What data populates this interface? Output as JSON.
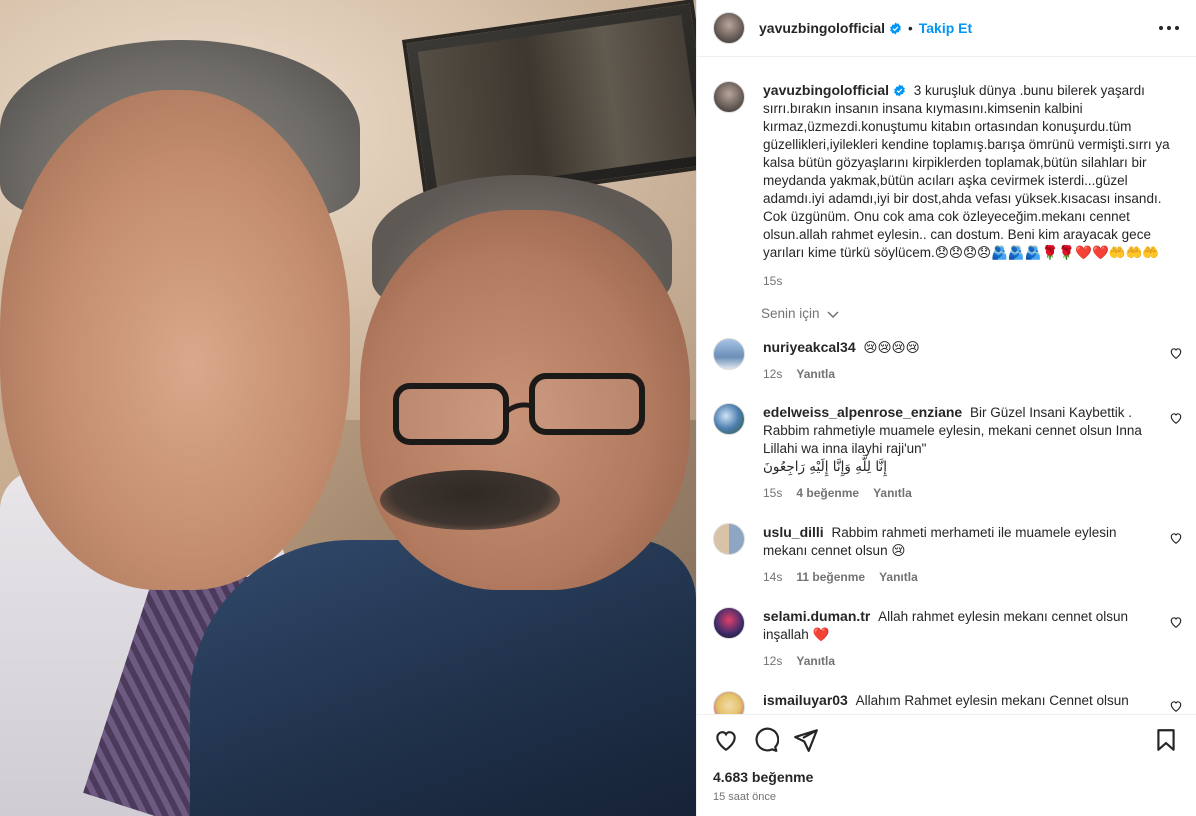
{
  "header": {
    "username": "yavuzbingolofficial",
    "separator": "•",
    "follow_label": "Takip Et"
  },
  "caption": {
    "username": "yavuzbingolofficial",
    "text": "3 kuruşluk dünya .bunu bilerek yaşardı sırrı.bırakın insanın insana kıymasını.kimsenin kalbini kırmaz,üzmezdi.konuştumu kitabın ortasından konuşurdu.tüm güzellikleri,iyilekleri kendine toplamış.barışa ömrünü vermişti.sırrı ya kalsa bütün gözyaşlarını kirpiklerden toplamak,bütün silahları bir meydanda yakmak,bütün acıları aşka cevirmek isterdi...güzel adamdı.iyi adamdı,iyi bir dost,ahda vefası yüksek.kısacası insandı. Cok üzgünüm. Onu cok ama cok özleyeceğim.mekanı cennet olsun.allah rahmet eylesin.. can dostum. Beni kim arayacak gece yarıları kime türkü söylücem.😞😞😞😞🫂🫂🫂🌹🌹❤️❤️🤲🤲🤲",
    "time": "15s"
  },
  "for_you": "Senin için",
  "comments": [
    {
      "username": "nuriyeakcal34",
      "text": "😢😢😢😢",
      "time": "12s",
      "likes": "",
      "reply": "Yanıtla"
    },
    {
      "username": "edelweiss_alpenrose_enziane",
      "text": "Bir Güzel Insani Kaybettik . Rabbim rahmetiyle muamele eylesin, mekani cennet olsun Inna Lillahi wa inna ilayhi raji'un\"",
      "arabic": "إِنَّا لِلَّهِ وَإِنَّا إِلَيْهِ رَاجِعُونَ",
      "time": "15s",
      "likes": "4 beğenme",
      "reply": "Yanıtla"
    },
    {
      "username": "uslu_dilli",
      "text": "Rabbim rahmeti merhameti ile muamele eylesin mekanı cennet olsun 😢",
      "time": "14s",
      "likes": "11 beğenme",
      "reply": "Yanıtla"
    },
    {
      "username": "selami.duman.tr",
      "text": "Allah rahmet eylesin mekanı cennet olsun inşallah ❤️",
      "time": "12s",
      "likes": "",
      "reply": "Yanıtla"
    },
    {
      "username": "ismailuyar03",
      "text": "Allahım Rahmet eylesin mekanı Cennet olsun",
      "time": "",
      "likes": "",
      "reply": ""
    }
  ],
  "footer": {
    "likes": "4.683 beğenme",
    "ago": "15 saat önce"
  },
  "colors": {
    "accent": "#0095f6",
    "verified": "#0095f6",
    "muted": "#737373",
    "text": "#262626"
  },
  "icons": {
    "more": "more-horizontal-icon",
    "heart": "heart-icon",
    "comment": "comment-icon",
    "share": "share-icon",
    "save": "bookmark-icon",
    "verified": "verified-badge-icon",
    "chevron": "chevron-down-icon"
  }
}
